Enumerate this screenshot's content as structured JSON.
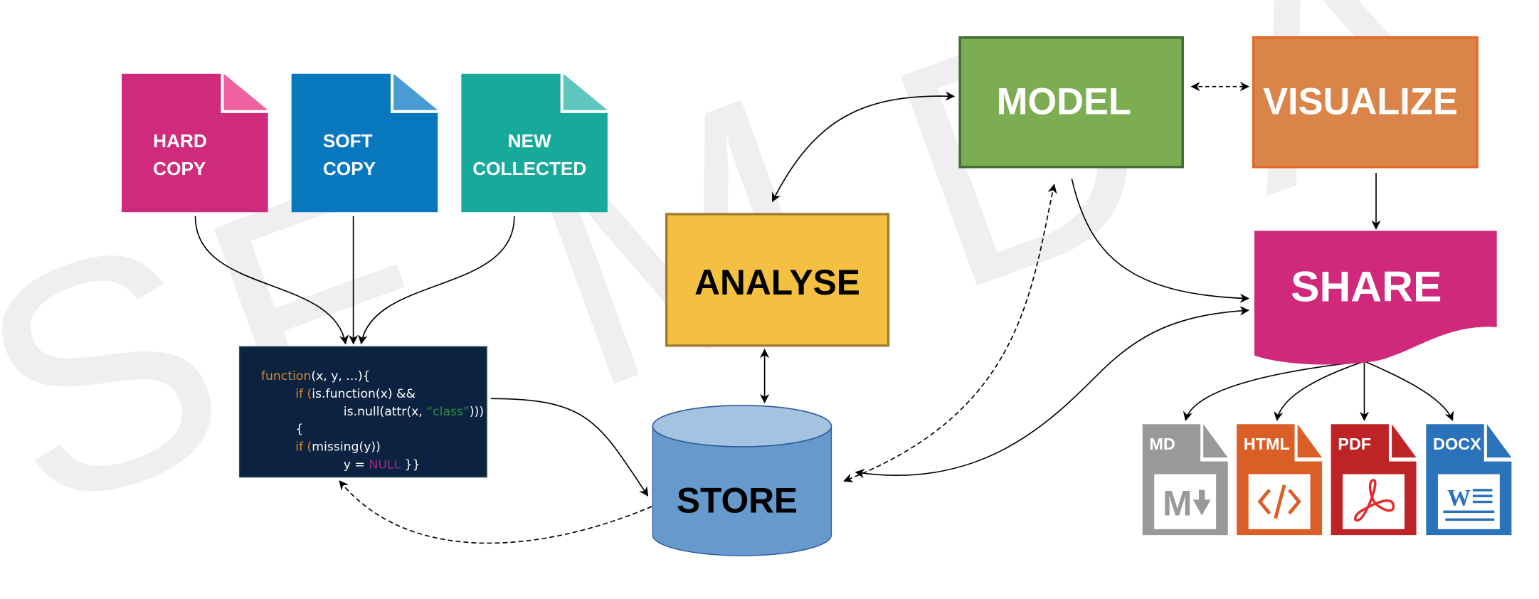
{
  "watermark": "SEMDA",
  "sources": [
    {
      "line1": "HARD",
      "line2": "COPY",
      "color": "#cf2a7b",
      "fold": "#ee60a0"
    },
    {
      "line1": "SOFT",
      "line2": "COPY",
      "color": "#0878be",
      "fold": "#4a9bd4"
    },
    {
      "line1": "NEW",
      "line2": "COLLECTED",
      "color": "#17aa9c",
      "fold": "#5ec6bd"
    }
  ],
  "code": {
    "l1_kw": "function",
    "l1_rest": "(x, y, ...){",
    "l2_kw": "if (",
    "l2_rest": "is.function(x) &&",
    "l3_a": "is.null(attr(x, ",
    "l3_str": "“class”",
    "l3_b": ")))",
    "l4": "{",
    "l5_kw": "if (",
    "l5_rest": "missing(y))",
    "l6_a": "y = ",
    "l6_null": "NULL",
    "l6_b": " }}",
    "colors": {
      "bg": "#0b2340",
      "keyword": "#d58a2c",
      "string": "#2e8b3e",
      "null": "#9b2a85"
    }
  },
  "stages": {
    "analyse": {
      "label": "ANALYSE",
      "color": "#f4c042"
    },
    "store": {
      "label": "STORE",
      "color": "#6699cc"
    },
    "model": {
      "label": "MODEL",
      "color": "#7dad52"
    },
    "visualize": {
      "label": "VISUALIZE",
      "color": "#db8449"
    },
    "share": {
      "label": "SHARE",
      "color": "#d0287a"
    }
  },
  "outputs": [
    {
      "label": "MD",
      "icon": "markdown-icon",
      "color": "#999999"
    },
    {
      "label": "HTML",
      "icon": "code-icon",
      "color": "#d95f27"
    },
    {
      "label": "PDF",
      "icon": "acrobat-icon",
      "color": "#be2326"
    },
    {
      "label": "DOCX",
      "icon": "word-icon",
      "color": "#2a73ba"
    }
  ]
}
